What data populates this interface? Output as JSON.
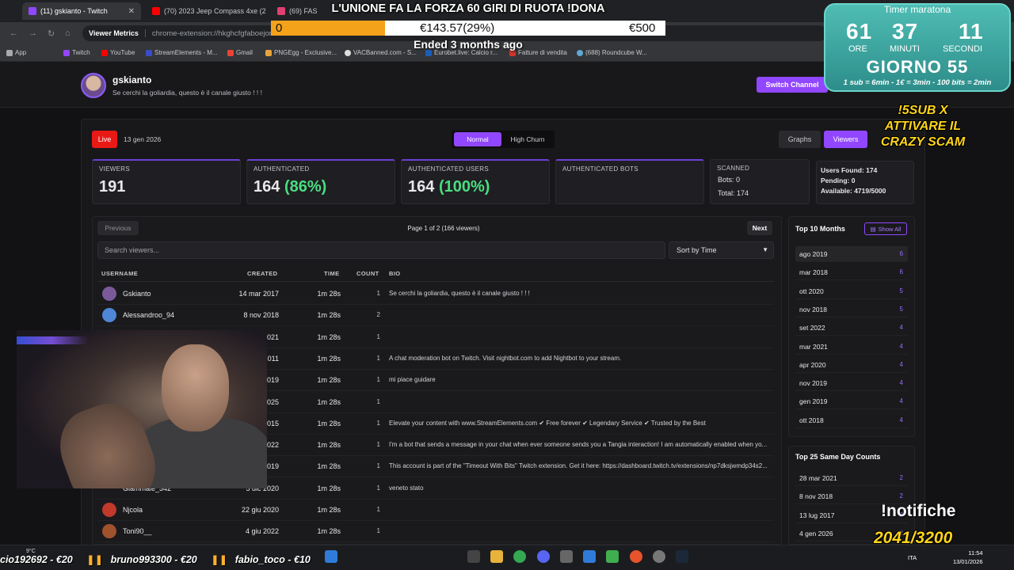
{
  "browser": {
    "tabs": [
      {
        "title": "(11) gskianto - Twitch",
        "color": "#9147ff",
        "active": true
      },
      {
        "title": "(70) 2023 Jeep Compass 4xe (2",
        "color": "#ff0000",
        "active": false
      },
      {
        "title": "(69) FAS",
        "color": "#e04070",
        "active": false
      }
    ],
    "extension": "Viewer Metrics",
    "url": "chrome-extension://hkghcfgfaboejon",
    "bookmarks": [
      "App",
      "Twitch",
      "YouTube",
      "StreamElements - M...",
      "Gmail",
      "PNGEgg - Exclusive...",
      "VACBanned.com - S...",
      "Eurobet.live: Calcio r...",
      "Fatture di vendita",
      "(688) Roundcube W..."
    ]
  },
  "channel": {
    "name": "gskianto",
    "bio": "Se cerchi la goliardia, questo è il canale giusto ! ! !",
    "switch_label": "Switch Channel"
  },
  "toolbar": {
    "live_label": "Live",
    "date": "13 gen 2026",
    "modes": [
      "Normal",
      "High Churn"
    ],
    "active_mode": "Normal",
    "views": [
      "Graphs",
      "Viewers"
    ],
    "active_view": "Viewers"
  },
  "stats": {
    "viewers": {
      "label": "VIEWERS",
      "value": "191"
    },
    "authenticated": {
      "label": "AUTHENTICATED",
      "value": "164",
      "pct": "(86%)"
    },
    "auth_users": {
      "label": "AUTHENTICATED USERS",
      "value": "164",
      "pct": "(100%)"
    },
    "auth_bots": {
      "label": "AUTHENTICATED BOTS"
    },
    "scanned": {
      "label": "SCANNED",
      "bots": "Bots: 0",
      "total": "Total: 174"
    },
    "found": {
      "users": "Users Found: 174",
      "pending": "Pending: 0",
      "available": "Available: 4719/5000"
    }
  },
  "table": {
    "prev_label": "Previous",
    "next_label": "Next",
    "page_info": "Page 1 of 2 (166 viewers)",
    "search_placeholder": "Search viewers...",
    "sort_label": "Sort by Time",
    "columns": {
      "username": "USERNAME",
      "created": "CREATED",
      "time": "TIME",
      "count": "COUNT",
      "bio": "BIO"
    },
    "rows": [
      {
        "username": "Gskianto",
        "created": "14 mar 2017",
        "time": "1m 28s",
        "count": "1",
        "bio": "Se cerchi la goliardia, questo è il canale giusto ! ! !",
        "avatar": "#7a5a9a"
      },
      {
        "username": "Alessandroo_94",
        "created": "8 nov 2018",
        "time": "1m 28s",
        "count": "2",
        "bio": "",
        "avatar": "#4f86d6"
      },
      {
        "username": "",
        "created": "021",
        "time": "1m 28s",
        "count": "1",
        "bio": "",
        "avatar": ""
      },
      {
        "username": "",
        "created": "011",
        "time": "1m 28s",
        "count": "1",
        "bio": "A chat moderation bot on Twitch. Visit nightbot.com to add Nightbot to your stream.",
        "avatar": ""
      },
      {
        "username": "",
        "created": "019",
        "time": "1m 28s",
        "count": "1",
        "bio": "mi piace guidare",
        "avatar": ""
      },
      {
        "username": "",
        "created": "025",
        "time": "1m 28s",
        "count": "1",
        "bio": "",
        "avatar": ""
      },
      {
        "username": "",
        "created": "015",
        "time": "1m 28s",
        "count": "1",
        "bio": "Elevate your content with www.StreamElements.com ✔ Free forever ✔ Legendary Service ✔ Trusted by the Best",
        "avatar": ""
      },
      {
        "username": "",
        "created": "022",
        "time": "1m 28s",
        "count": "1",
        "bio": "I'm a bot that sends a message in your chat when ever someone sends you a Tangia interaction! I am automatically enabled when yo...",
        "avatar": ""
      },
      {
        "username": "",
        "created": "019",
        "time": "1m 28s",
        "count": "1",
        "bio": "This account is part of the \"Timeout With Bits\" Twitch extension. Get it here: https://dashboard.twitch.tv/extensions/np7dksjwmdp34s2...",
        "avatar": ""
      },
      {
        "username": "Giammale_342",
        "created": "5 dic 2020",
        "time": "1m 28s",
        "count": "1",
        "bio": "veneto stato",
        "avatar": ""
      },
      {
        "username": "Njcola",
        "created": "22 giu 2020",
        "time": "1m 28s",
        "count": "1",
        "bio": "",
        "avatar": "#c0392b"
      },
      {
        "username": "Toni90__",
        "created": "4 giu 2022",
        "time": "1m 28s",
        "count": "1",
        "bio": "",
        "avatar": "#a0522d"
      }
    ]
  },
  "top_months": {
    "title": "Top 10 Months",
    "show_all": "Show All",
    "items": [
      {
        "label": "ago 2019",
        "value": "6"
      },
      {
        "label": "mar 2018",
        "value": "6"
      },
      {
        "label": "ott 2020",
        "value": "5"
      },
      {
        "label": "nov 2018",
        "value": "5"
      },
      {
        "label": "set 2022",
        "value": "4"
      },
      {
        "label": "mar 2021",
        "value": "4"
      },
      {
        "label": "apr 2020",
        "value": "4"
      },
      {
        "label": "nov 2019",
        "value": "4"
      },
      {
        "label": "gen 2019",
        "value": "4"
      },
      {
        "label": "ott 2018",
        "value": "4"
      }
    ]
  },
  "top_days": {
    "title": "Top 25 Same Day Counts",
    "items": [
      {
        "label": "28 mar 2021",
        "value": "2"
      },
      {
        "label": "8 nov 2018",
        "value": "2"
      },
      {
        "label": "13 lug 2017",
        "value": "2"
      },
      {
        "label": "4 gen 2026",
        "value": "2"
      }
    ]
  },
  "overlay": {
    "donation_title": "L'UNIONE FA LA FORZA 60 GIRI DI RUOTA !DONA",
    "donation_start": "0",
    "donation_current": "€143.57(29%)",
    "donation_goal": "€500",
    "donation_progress": 0.29,
    "donation_status": "Ended 3 months ago",
    "timer_title": "Timer maratona",
    "hours": "61",
    "minutes": "37",
    "seconds": "11",
    "label_h": "ORE",
    "label_m": "MINUTI",
    "label_s": "SECONDI",
    "day": "GIORNO 55",
    "rates": "1 sub = 6min - 1€ = 3min - 100 bits = 2min",
    "sub_cmd": "!5SUB X ATTIVARE IL CRAZY SCAM",
    "notifiche": "!notifiche",
    "notif_count": "2041/3200"
  },
  "taskbar": {
    "ticker": [
      {
        "name": "cio192692",
        "amount": "€20"
      },
      {
        "name": "bruno993300",
        "amount": "€20"
      },
      {
        "name": "fabio_toco",
        "amount": "€10"
      }
    ],
    "weather": "9°C",
    "lang": "ITA",
    "time": "11:54",
    "date": "13/01/2026"
  }
}
